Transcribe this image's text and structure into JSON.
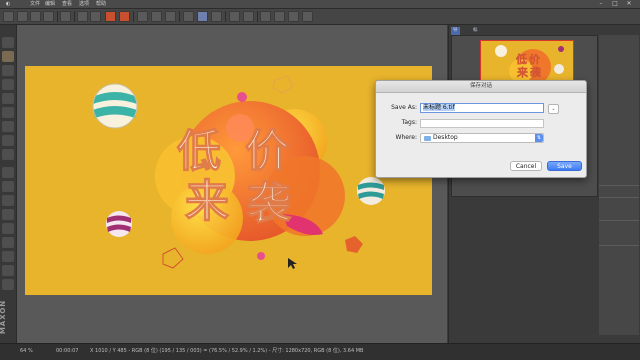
{
  "menubar": {
    "items": [
      "文件",
      "编辑",
      "查看",
      "选项",
      "帮助"
    ]
  },
  "right_panel": {
    "tabs": [
      "导航器",
      "标识"
    ]
  },
  "artwork": {
    "title_chars": [
      "低",
      "价",
      "来",
      "袭"
    ]
  },
  "status_bar": {
    "zoom": "64 %",
    "time": "00:00:07",
    "info": "X 1010 / Y 485 - RGB (8 位) (195 / 135 / 003) = (76.5% / 52.9% / 1.2%) - 尺寸: 1280x720, RGB (8 位), 3.64 MB"
  },
  "dialog": {
    "title": "保存对话",
    "save_as_label": "Save As:",
    "filename": "未标题 6.tif",
    "tags_label": "Tags:",
    "where_label": "Where:",
    "where_value": "Desktop",
    "cancel_label": "Cancel",
    "save_label": "Save"
  },
  "colors": {
    "canvas_bg": "#e8b42c",
    "accent_blue": "#3c7cf2",
    "title_text": "#fdf3e1"
  }
}
